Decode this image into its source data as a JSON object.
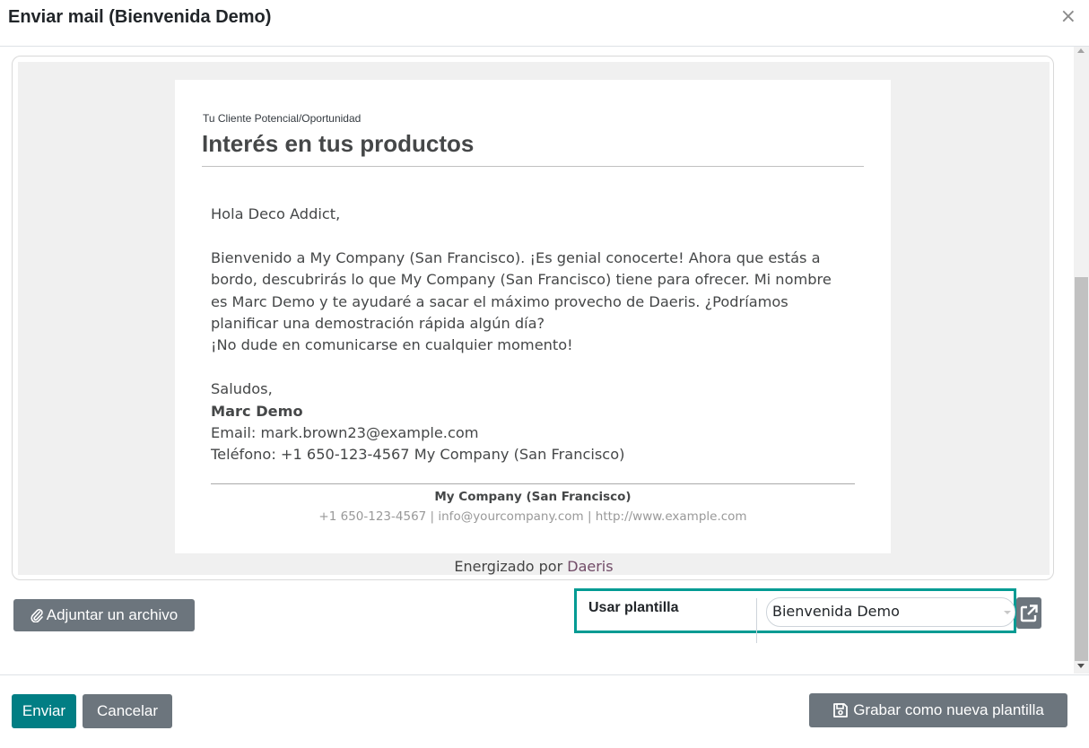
{
  "dialog": {
    "title": "Enviar mail (Bienvenida Demo)",
    "close_symbol": "×"
  },
  "email_preview": {
    "breadcrumb": "Tu Cliente Potencial/Oportunidad",
    "heading": "Interés en tus productos",
    "greeting": "Hola Deco Addict,",
    "body_lines": [
      "Bienvenido a My Company (San Francisco). ¡Es genial conocerte! Ahora que estás a",
      "bordo, descubrirás lo que My Company (San Francisco) tiene para ofrecer. Mi nombre",
      "es Marc Demo y te ayudaré a sacar el máximo provecho de Daeris. ¿Podríamos",
      "planificar una demostración rápida algún día?",
      "¡No dude en comunicarse en cualquier momento!"
    ],
    "closing": "Saludos,",
    "signature_name": "Marc Demo",
    "signature_email": "Email: mark.brown23@example.com",
    "signature_phone": "Teléfono: +1 650-123-4567 My Company (San Francisco)",
    "footer_company": "My Company (San Francisco)",
    "footer_contact": "+1 650-123-4567 | info@yourcompany.com | http://www.example.com"
  },
  "powered_by": {
    "prefix": "Energizado por",
    "brand": "Daeris"
  },
  "attach_button": {
    "icon": "paperclip-icon",
    "label": "Adjuntar un archivo"
  },
  "template": {
    "label": "Usar plantilla",
    "value": "Bienvenida Demo",
    "external_icon": "external-link-icon"
  },
  "footer": {
    "send_label": "Enviar",
    "cancel_label": "Cancelar",
    "save_template_icon": "floppy-disk-icon",
    "save_template_label": "Grabar como nueva plantilla"
  },
  "colors": {
    "primary": "#017e84",
    "secondary": "#6c757d",
    "highlight_border": "#009b93",
    "brand_link": "#714b67"
  }
}
